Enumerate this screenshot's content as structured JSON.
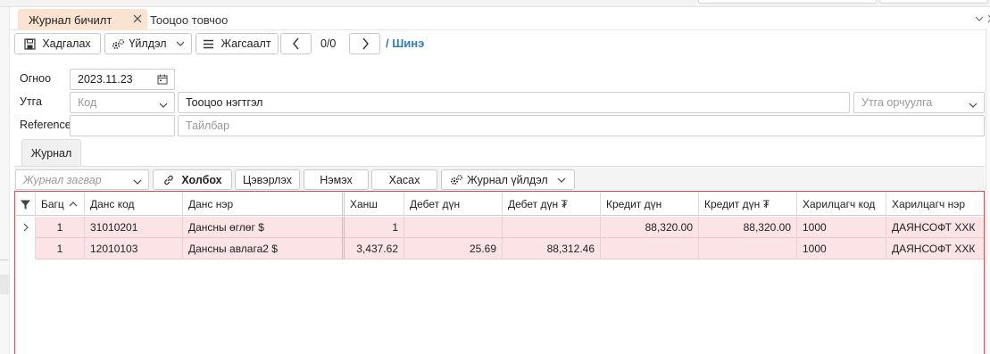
{
  "tabs": {
    "active": "Журнал бичилт",
    "inactive": "Тооцоо товчоо"
  },
  "toolbar": {
    "save": "Хадгалах",
    "process": "Үйлдэл",
    "list": "Жагсаалт",
    "pager": "0/0",
    "new_label": "/ Шинэ"
  },
  "form": {
    "date_label": "Огноо",
    "date_value": "2023.11.23",
    "journal_label": "Утга",
    "code_placeholder": "Код",
    "journal_value": "Тооцоо нэгтгэл",
    "translation_placeholder": "Утга орчуулга",
    "reference_label": "Reference",
    "reference_value": "",
    "description_placeholder": "Тайлбар"
  },
  "section_tab": "Журнал",
  "grid_toolbar": {
    "template_placeholder": "Журнал загвар",
    "link": "Холбох",
    "clear": "Цэвэрлэх",
    "add": "Нэмэх",
    "remove": "Хасах",
    "journal_process": "Журнал үйлдэл"
  },
  "grid": {
    "columns": [
      "Багц",
      "Данс код",
      "Данс нэр",
      "Ханш",
      "Дебет дүн",
      "Дебет дүн ₮",
      "Кредит дүн",
      "Кредит дүн ₮",
      "Харилцагч код",
      "Харилцагч нэр"
    ],
    "rows": [
      {
        "batch": "1",
        "account_code": "31010201",
        "account_name": "Дансны өглөг $",
        "rate": "1",
        "debit": "",
        "debit_mnt": "",
        "credit": "88,320.00",
        "credit_mnt": "88,320.00",
        "partner_code": "1000",
        "partner_name": "ДАЯНСОФТ ХХК"
      },
      {
        "batch": "1",
        "account_code": "12010103",
        "account_name": "Дансны авлага2 $",
        "rate": "3,437.62",
        "debit": "25.69",
        "debit_mnt": "88,312.46",
        "credit": "",
        "credit_mnt": "",
        "partner_code": "1000",
        "partner_name": "ДАЯНСОФТ ХХК"
      }
    ]
  },
  "colors": {
    "accent": "#2e7cc4",
    "active_tab": "#fbe3d2",
    "row_highlight": "#fce3e5",
    "grid_border": "#e04848"
  }
}
